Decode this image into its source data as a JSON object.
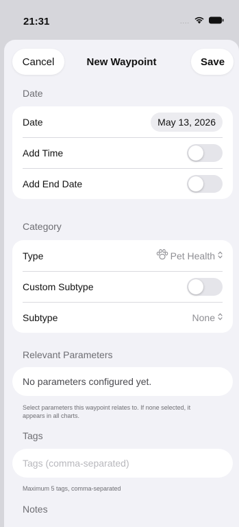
{
  "status_bar": {
    "time": "21:31",
    "carrier_dots": "....",
    "icons": [
      "wifi-icon",
      "battery-icon"
    ]
  },
  "nav": {
    "cancel_label": "Cancel",
    "title": "New Waypoint",
    "save_label": "Save"
  },
  "sections": {
    "date": {
      "header": "Date",
      "rows": {
        "date_label": "Date",
        "date_value": "May 13, 2026",
        "add_time_label": "Add Time",
        "add_time_on": false,
        "add_end_date_label": "Add End Date",
        "add_end_date_on": false
      }
    },
    "category": {
      "header": "Category",
      "rows": {
        "type_label": "Type",
        "type_value": "Pet Health",
        "type_icon": "paw-icon",
        "custom_subtype_label": "Custom Subtype",
        "custom_subtype_on": false,
        "subtype_label": "Subtype",
        "subtype_value": "None"
      }
    },
    "parameters": {
      "header": "Relevant Parameters",
      "empty_text": "No parameters configured yet.",
      "footnote": "Select parameters this waypoint relates to. If none selected, it appears in all charts."
    },
    "tags": {
      "header": "Tags",
      "placeholder": "Tags (comma-separated)",
      "value": "",
      "footnote": "Maximum 5 tags, comma-separated"
    },
    "notes": {
      "header": "Notes"
    }
  },
  "colors": {
    "background": "#d6d6db",
    "sheet": "#f2f2f7",
    "card": "#ffffff",
    "secondary_text": "#6e6e73",
    "toggle_off": "#e5e5ea"
  }
}
